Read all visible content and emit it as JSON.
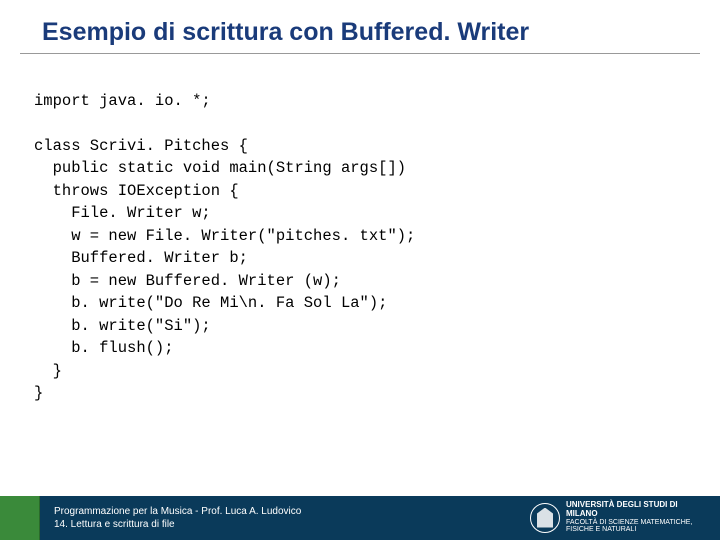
{
  "title": "Esempio di scrittura con Buffered. Writer",
  "code": {
    "l1": "import java. io. *;",
    "l2": "class Scrivi. Pitches {",
    "l3": "  public static void main(String args[])",
    "l4": "  throws IOException {",
    "l5": "    File. Writer w;",
    "l6": "    w = new File. Writer(\"pitches. txt\");",
    "l7": "    Buffered. Writer b;",
    "l8": "    b = new Buffered. Writer (w);",
    "l9": "    b. write(\"Do Re Mi\\n. Fa Sol La\");",
    "l10": "    b. write(\"Si\");",
    "l11": "    b. flush();",
    "l12": "  }",
    "l13": "}"
  },
  "footer": {
    "line1": "Programmazione per la Musica - Prof. Luca A. Ludovico",
    "line2": "14. Lettura e scrittura di file",
    "logo_university": "UNIVERSITÀ DEGLI STUDI DI MILANO",
    "logo_faculty": "FACOLTÀ DI SCIENZE MATEMATICHE,",
    "logo_faculty2": "FISICHE E NATURALI"
  }
}
